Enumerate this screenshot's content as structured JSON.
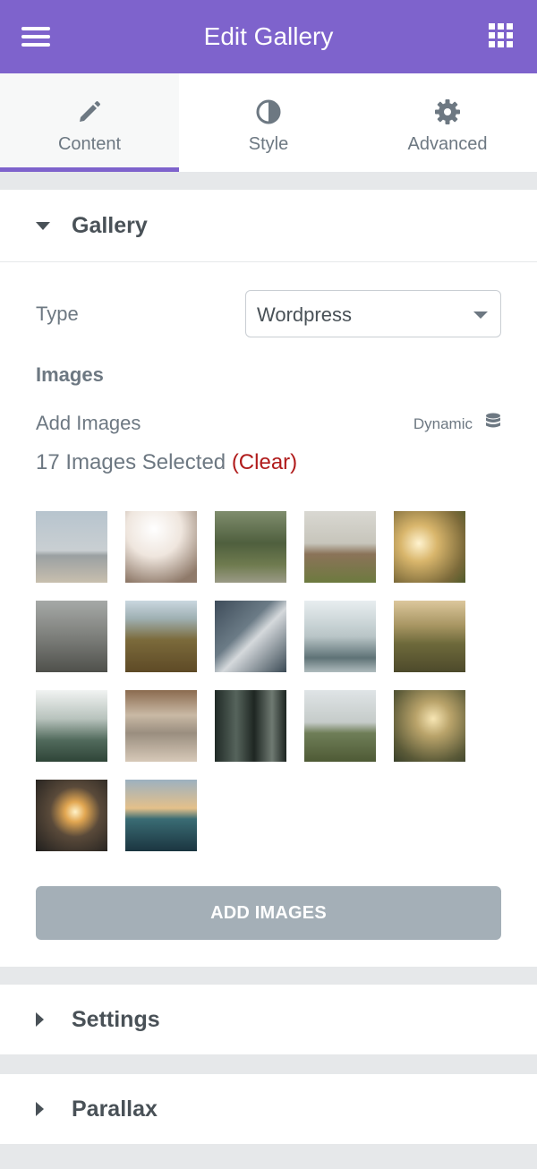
{
  "header": {
    "title": "Edit Gallery"
  },
  "tabs": [
    {
      "label": "Content",
      "icon": "pencil-icon"
    },
    {
      "label": "Style",
      "icon": "half-circle-icon"
    },
    {
      "label": "Advanced",
      "icon": "gear-icon"
    }
  ],
  "gallery": {
    "title": "Gallery",
    "type_label": "Type",
    "type_value": "Wordpress",
    "images_label": "Images",
    "add_images_label": "Add Images",
    "dynamic_label": "Dynamic",
    "selected_text": "17 Images Selected ",
    "clear_label": "(Clear)",
    "thumbnail_count": 17,
    "add_button": "ADD IMAGES"
  },
  "sections": {
    "settings": "Settings",
    "parallax": "Parallax"
  },
  "colors": {
    "accent": "#7e63cc",
    "clear": "#b01b1b",
    "button": "#a4afb7"
  }
}
